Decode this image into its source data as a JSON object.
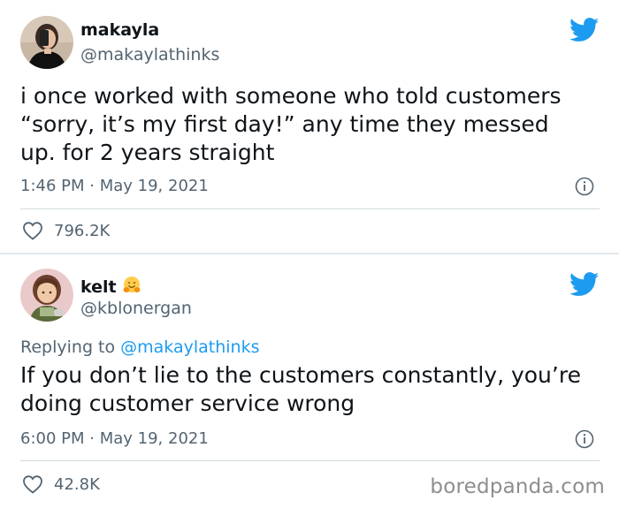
{
  "tweets": [
    {
      "display_name": "makayla",
      "handle": "@makaylathinks",
      "body_lines": [
        "i once worked with someone who told customers",
        "“sorry, it’s my first day!” any time they messed",
        "up. for 2 years straight"
      ],
      "time": "1:46 PM",
      "date_sep": " · ",
      "date": "May 19, 2021",
      "likes": "796.2K",
      "avatar_icon": "avatar-photo-icon",
      "bird_icon": "twitter-bird-icon"
    },
    {
      "display_name": "kelt",
      "emoji": "hugging-face-emoji",
      "handle": "@kblonergan",
      "replying_prefix": "Replying to ",
      "replying_to": "@makaylathinks",
      "body_lines": [
        "If you don’t lie to the customers constantly, you’re",
        "doing customer service wrong"
      ],
      "time": "6:00 PM",
      "date_sep": " · ",
      "date": "May 19, 2021",
      "likes": "42.8K",
      "avatar_icon": "avatar-illustration-icon",
      "bird_icon": "twitter-bird-icon"
    }
  ],
  "watermark": "boredpanda.com",
  "colors": {
    "twitter_blue": "#1d9bf0",
    "secondary_text": "#536471",
    "primary_text": "#0f1419"
  }
}
